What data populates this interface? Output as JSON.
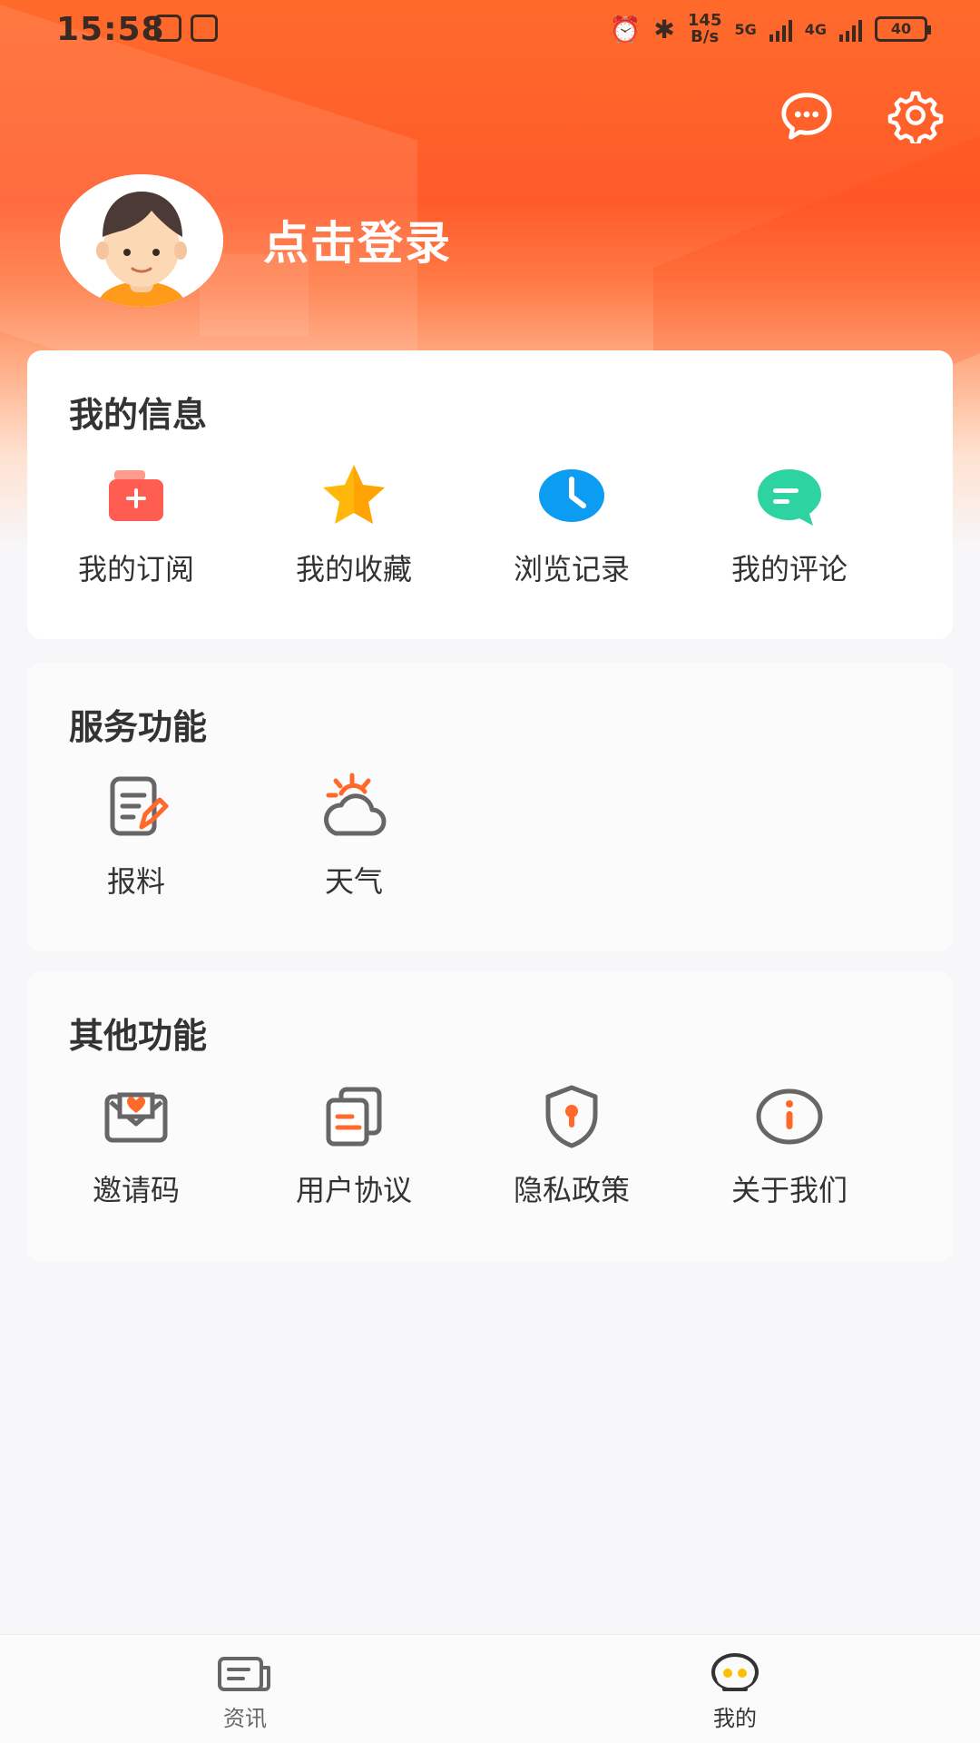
{
  "status_bar": {
    "time": "15:58",
    "network_speed_value": "145",
    "network_speed_unit": "B/s",
    "signal_1": "5G",
    "signal_2": "4G",
    "battery": "40"
  },
  "header": {
    "login_text": "点击登录",
    "icons": [
      "message-icon",
      "settings-icon"
    ]
  },
  "sections": {
    "my_info": {
      "title": "我的信息",
      "items": [
        {
          "label": "我的订阅",
          "icon": "subscription-icon"
        },
        {
          "label": "我的收藏",
          "icon": "favorite-icon"
        },
        {
          "label": "浏览记录",
          "icon": "history-icon"
        },
        {
          "label": "我的评论",
          "icon": "comment-icon"
        }
      ]
    },
    "service": {
      "title": "服务功能",
      "items": [
        {
          "label": "报料",
          "icon": "report-icon"
        },
        {
          "label": "天气",
          "icon": "weather-icon"
        }
      ]
    },
    "other": {
      "title": "其他功能",
      "items": [
        {
          "label": "邀请码",
          "icon": "invite-code-icon"
        },
        {
          "label": "用户协议",
          "icon": "user-agreement-icon"
        },
        {
          "label": "隐私政策",
          "icon": "privacy-policy-icon"
        },
        {
          "label": "关于我们",
          "icon": "about-us-icon"
        }
      ]
    }
  },
  "bottom_nav": {
    "items": [
      {
        "label": "资讯",
        "icon": "news-tab-icon",
        "active": false
      },
      {
        "label": "我的",
        "icon": "profile-tab-icon",
        "active": true
      }
    ]
  },
  "colors": {
    "brand_orange": "#ff5b2a",
    "text_dark": "#333333",
    "text_mid": "#666666",
    "blue": "#1ea1f7",
    "green": "#2dd3a0",
    "gold": "#ffb800",
    "red": "#ff5a4f"
  }
}
